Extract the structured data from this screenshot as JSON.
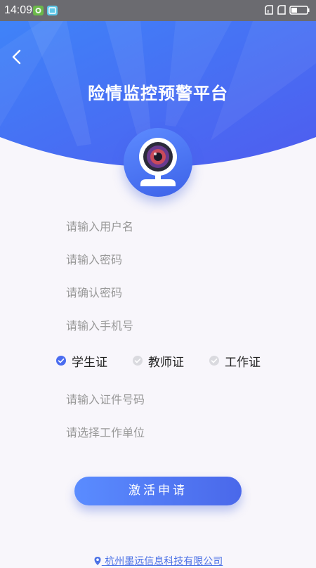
{
  "status_bar": {
    "time": "14:09",
    "icons": [
      "app-notification-icon-green",
      "app-notification-icon-blue",
      "signal-icon",
      "signal-icon",
      "battery-icon"
    ]
  },
  "header": {
    "back_icon": "chevron-left-icon",
    "title": "险情监控预警平台",
    "colors": {
      "gradient_start": "#3f7cf5",
      "gradient_end": "#4e5ef0"
    }
  },
  "avatar": {
    "icon": "camera-icon"
  },
  "form": {
    "username_placeholder": "请输入用户名",
    "password_placeholder": "请输入密码",
    "confirm_password_placeholder": "请确认密码",
    "phone_placeholder": "请输入手机号",
    "id_types": [
      {
        "label": "学生证",
        "selected": true
      },
      {
        "label": "教师证",
        "selected": false
      },
      {
        "label": "工作证",
        "selected": false
      }
    ],
    "id_number_placeholder": "请输入证件号码",
    "work_unit_placeholder": "请选择工作单位"
  },
  "actions": {
    "submit_label": "激活申请"
  },
  "footer": {
    "icon": "location-pin-icon",
    "company": "杭州墨远信息科技有限公司"
  },
  "colors": {
    "accent": "#4a6cf0",
    "radio_selected": "#4a6cf0",
    "radio_unselected": "#d7d7dc",
    "placeholder": "#999999",
    "page_background": "#f8f6fb"
  }
}
